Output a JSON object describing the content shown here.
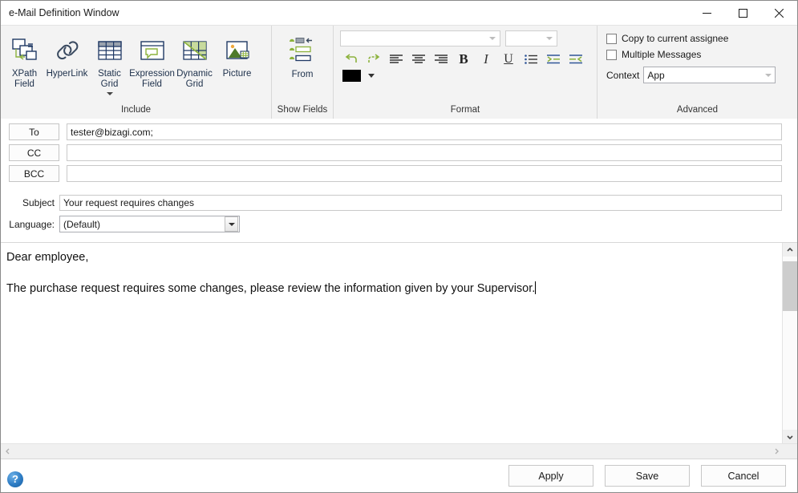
{
  "window": {
    "title": "e-Mail Definition Window",
    "controls": {
      "minimize": "minimize-button",
      "maximize": "maximize-button",
      "close": "close-button"
    }
  },
  "ribbon": {
    "groups": [
      {
        "label": "Include"
      },
      {
        "label": "Show Fields"
      },
      {
        "label": "Format"
      },
      {
        "label": "Advanced"
      }
    ],
    "include": {
      "label": "Include",
      "buttons": [
        {
          "label": "XPath\nField",
          "icon": "xpath-field-icon",
          "has_menu": false
        },
        {
          "label": "HyperLink",
          "icon": "hyperlink-icon",
          "has_menu": false
        },
        {
          "label": "Static\nGrid",
          "icon": "static-grid-icon",
          "has_menu": true
        },
        {
          "label": "Expression\nField",
          "icon": "expression-field-icon",
          "has_menu": false
        },
        {
          "label": "Dynamic\nGrid",
          "icon": "dynamic-grid-icon",
          "has_menu": false
        },
        {
          "label": "Picture",
          "icon": "picture-icon",
          "has_menu": false
        }
      ]
    },
    "show_fields": {
      "label": "Show Fields",
      "from_button": {
        "label": "From",
        "icon": "from-fields-icon"
      }
    },
    "format": {
      "label": "Format",
      "font_name": {
        "value": "",
        "placeholder": ""
      },
      "font_size": {
        "value": "",
        "placeholder": ""
      },
      "buttons": [
        {
          "name": "undo-icon",
          "label": "Undo"
        },
        {
          "name": "redo-icon",
          "label": "Redo"
        },
        {
          "name": "align-left-icon",
          "label": "Align Left"
        },
        {
          "name": "align-center-icon",
          "label": "Align Center"
        },
        {
          "name": "align-right-icon",
          "label": "Align Right"
        },
        {
          "name": "bold-icon",
          "label": "B"
        },
        {
          "name": "italic-icon",
          "label": "I"
        },
        {
          "name": "underline-icon",
          "label": "U"
        },
        {
          "name": "bullet-list-icon",
          "label": "Bullets"
        },
        {
          "name": "increase-indent-icon",
          "label": "Increase Indent"
        },
        {
          "name": "decrease-indent-icon",
          "label": "Decrease Indent"
        }
      ],
      "font_color": "#000000"
    },
    "advanced": {
      "label": "Advanced",
      "copy_to_current_assignee": {
        "label": "Copy to current assignee",
        "checked": false
      },
      "multiple_messages": {
        "label": "Multiple Messages",
        "checked": false
      },
      "context": {
        "label": "Context",
        "value": "App"
      }
    }
  },
  "recipients": [
    {
      "button": "To",
      "value": "tester@bizagi.com;"
    },
    {
      "button": "CC",
      "value": ""
    },
    {
      "button": "BCC",
      "value": ""
    }
  ],
  "subject": {
    "label": "Subject",
    "value": "Your request requires changes"
  },
  "language": {
    "label": "Language:",
    "value": "(Default)"
  },
  "editor": {
    "paragraphs": [
      "Dear employee,",
      "The purchase request requires some changes, please review the information given by your Supervisor."
    ]
  },
  "footer": {
    "help": {
      "label": "?",
      "icon": "help-icon"
    },
    "buttons": [
      {
        "label": "Apply"
      },
      {
        "label": "Save"
      },
      {
        "label": "Cancel"
      }
    ]
  },
  "colors": {
    "accent_green": "#8cb23c",
    "dark_blue": "#1f3864",
    "ribbon_bg": "#f3f3f3"
  }
}
